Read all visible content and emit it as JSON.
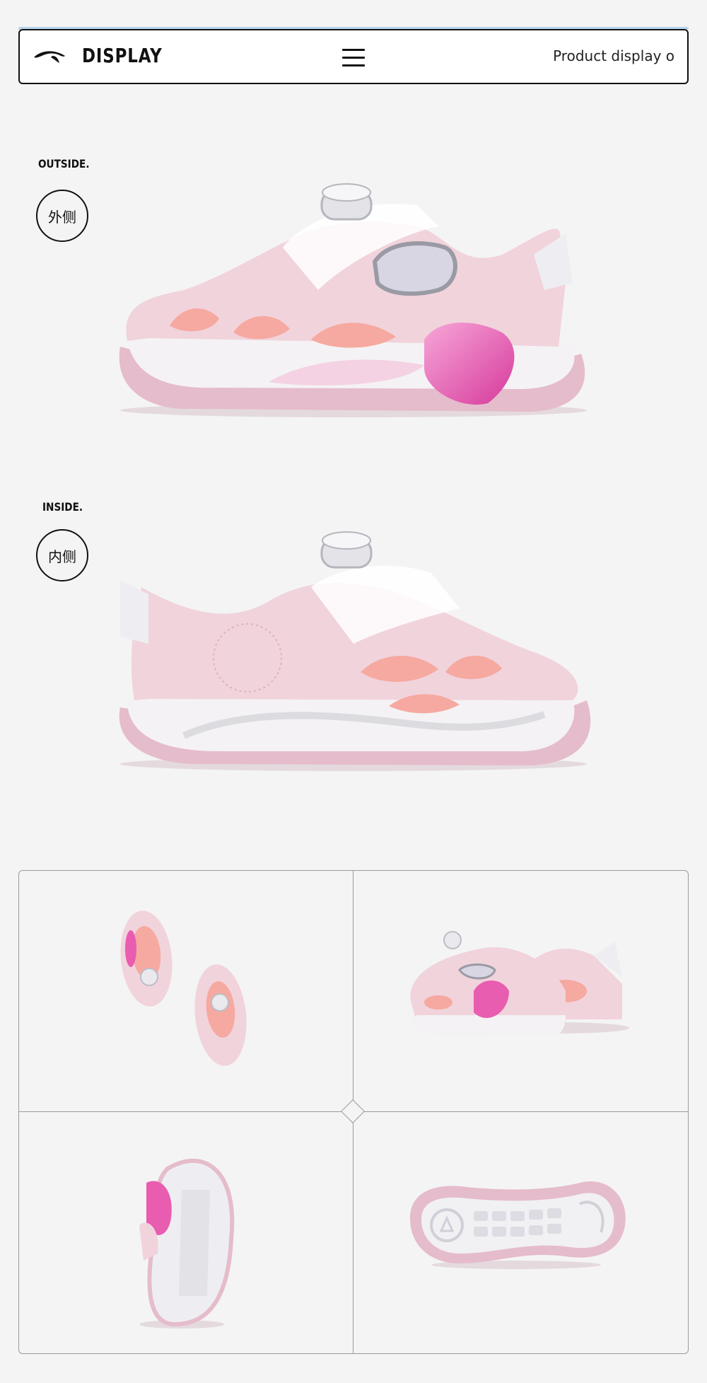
{
  "header": {
    "brand": "DISPLAY",
    "right_text": "Product display o",
    "logo_icon": "anta-logo",
    "menu_icon": "hamburger-menu-icon"
  },
  "outside": {
    "label": "OUTSIDE.",
    "badge": "外侧"
  },
  "inside": {
    "label": "INSIDE.",
    "badge": "内侧"
  },
  "colors": {
    "background": "#f4f4f4",
    "shoe_pink": "#f1d3dc",
    "accent_pink": "#e85db0",
    "sole_white": "#f4f2f4",
    "outsole": "#e5bccb"
  },
  "gallery": {
    "items": [
      "top-view-pair",
      "three-quarter-pair",
      "back-view",
      "sole-view"
    ]
  }
}
